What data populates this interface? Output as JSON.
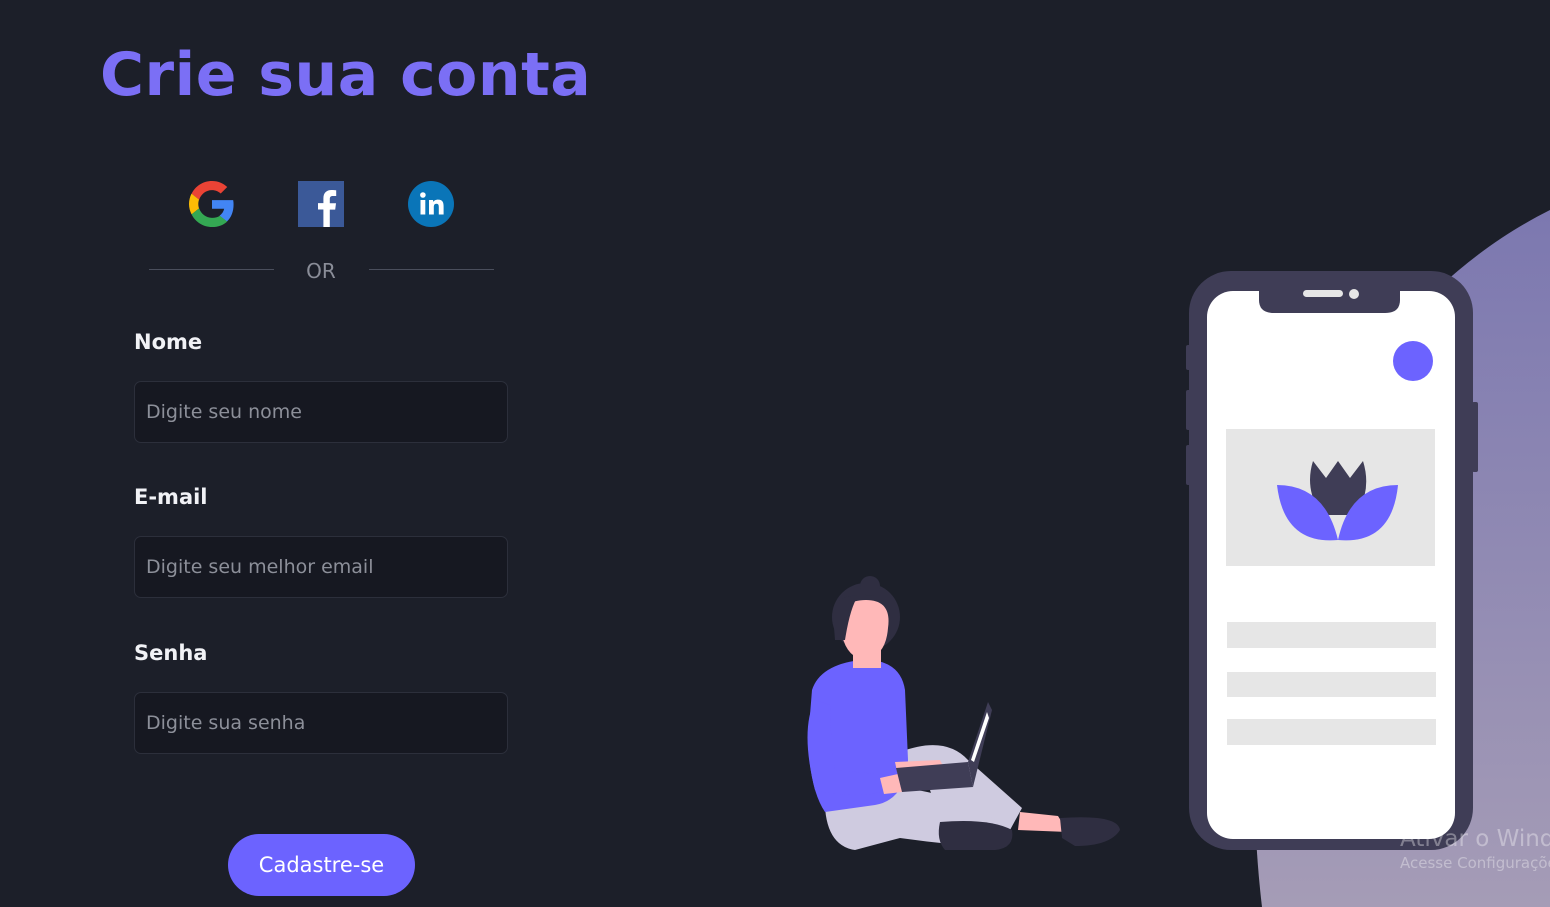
{
  "page": {
    "title": "Crie sua conta"
  },
  "social": {
    "google": {
      "icon": "google-icon"
    },
    "facebook": {
      "icon": "facebook-icon"
    },
    "linkedin": {
      "icon": "linkedin-icon"
    }
  },
  "divider": {
    "text": "OR"
  },
  "form": {
    "name": {
      "label": "Nome",
      "placeholder": "Digite seu nome",
      "value": ""
    },
    "email": {
      "label": "E-mail",
      "placeholder": "Digite seu melhor email",
      "value": ""
    },
    "password": {
      "label": "Senha",
      "placeholder": "Digite sua senha",
      "value": ""
    },
    "submit_label": "Cadastre-se"
  },
  "watermark": {
    "line1": "Ativar o Windows",
    "line2": "Acesse Configurações para ativar o Windows."
  },
  "colors": {
    "accent": "#6c63ff",
    "title": "#7b6ff5",
    "background": "#1c1f29"
  }
}
